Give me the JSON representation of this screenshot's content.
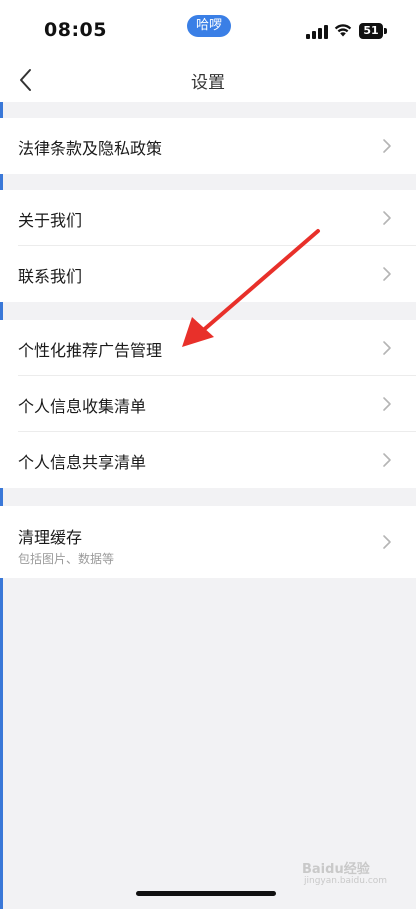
{
  "status_bar": {
    "time": "08:05",
    "pill_label": "哈啰",
    "battery_level": "51"
  },
  "nav": {
    "title": "设置"
  },
  "groups": [
    {
      "items": [
        {
          "label": "法律条款及隐私政策"
        }
      ]
    },
    {
      "items": [
        {
          "label": "关于我们"
        },
        {
          "label": "联系我们"
        }
      ]
    },
    {
      "items": [
        {
          "label": "个性化推荐广告管理"
        },
        {
          "label": "个人信息收集清单"
        },
        {
          "label": "个人信息共享清单"
        }
      ]
    },
    {
      "items": [
        {
          "label": "清理缓存",
          "sublabel": "包括图片、数据等"
        }
      ]
    }
  ],
  "annotation": {
    "color": "#e8302a"
  },
  "watermark": {
    "text": "Baidu经验",
    "sub": "jingyan.baidu.com"
  },
  "colors": {
    "accent": "#3a7fe6",
    "background": "#f2f2f4",
    "chevron": "#b5b5b5"
  }
}
